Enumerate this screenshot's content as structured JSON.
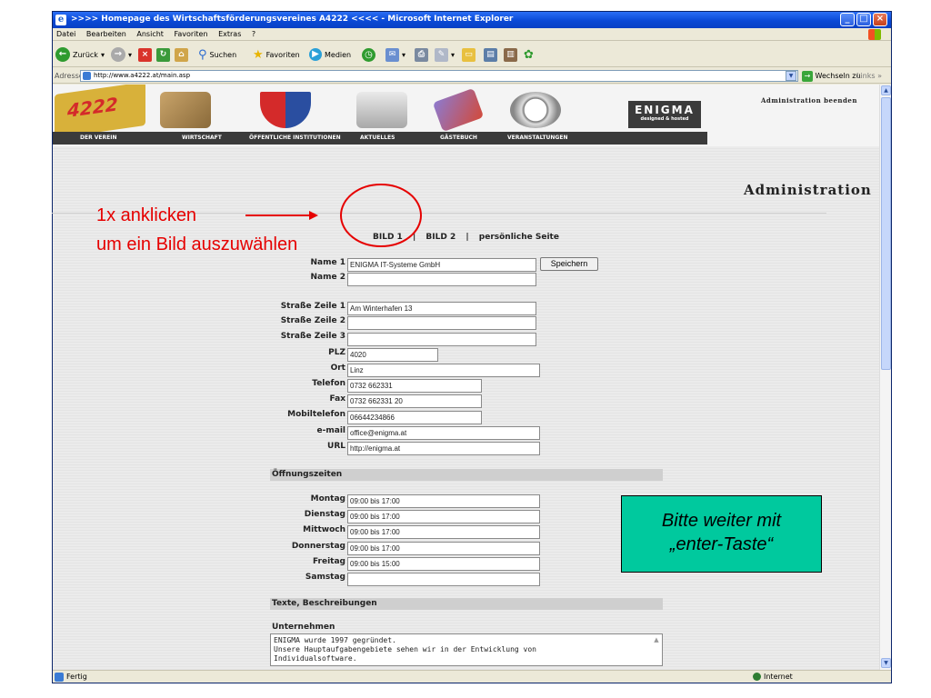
{
  "window": {
    "title": ">>>> Homepage des Wirtschaftsförderungsvereines A4222 <<<< - Microsoft Internet Explorer"
  },
  "menu": [
    "Datei",
    "Bearbeiten",
    "Ansicht",
    "Favoriten",
    "Extras",
    "?"
  ],
  "toolbar": {
    "back": "Zurück",
    "search": "Suchen",
    "favorites": "Favoriten",
    "media": "Medien"
  },
  "address": {
    "label": "Adresse",
    "url": "http://www.a4222.at/main.asp",
    "go": "Wechseln zu",
    "links": "Links"
  },
  "banner": {
    "logo": "4222",
    "nav": [
      "DER VEREIN",
      "WIRTSCHAFT",
      "ÖFFENTLICHE INSTITUTIONEN",
      "AKTUELLES",
      "GÄSTEBUCH",
      "VERANSTALTUNGEN"
    ],
    "enigma": "ENIGMA",
    "enigma_sub": "designed & hosted"
  },
  "admin": {
    "end_link": "Administration beenden",
    "title": "Administration"
  },
  "tabs": [
    "BILD 1",
    "|",
    "BILD 2",
    "|",
    "persönliche Seite"
  ],
  "form": {
    "save_label": "Speichern",
    "name1_label": "Name 1",
    "name1_value": "ENIGMA IT-Systeme GmbH",
    "name2_label": "Name 2",
    "name2_value": "",
    "street1_label": "Straße Zeile 1",
    "street1_value": "Am Winterhafen 13",
    "street2_label": "Straße Zeile 2",
    "street2_value": "",
    "street3_label": "Straße Zeile 3",
    "street3_value": "",
    "plz_label": "PLZ",
    "plz_value": "4020",
    "ort_label": "Ort",
    "ort_value": "Linz",
    "tel_label": "Telefon",
    "tel_value": "0732 662331",
    "fax_label": "Fax",
    "fax_value": "0732 662331 20",
    "mobile_label": "Mobiltelefon",
    "mobile_value": "06644234866",
    "email_label": "e-mail",
    "email_value": "office@enigma.at",
    "url_label": "URL",
    "url_value": "http://enigma.at"
  },
  "hours": {
    "heading": "Öffnungszeiten",
    "mo_label": "Montag",
    "mo_value": "09:00 bis 17:00",
    "di_label": "Dienstag",
    "di_value": "09:00 bis 17:00",
    "mi_label": "Mittwoch",
    "mi_value": "09:00 bis 17:00",
    "do_label": "Donnerstag",
    "do_value": "09:00 bis 17:00",
    "fr_label": "Freitag",
    "fr_value": "09:00 bis 15:00",
    "sa_label": "Samstag",
    "sa_value": ""
  },
  "texts": {
    "heading": "Texte, Beschreibungen",
    "company_label": "Unternehmen",
    "company_value": "ENIGMA wurde 1997 gegründet.\nUnsere Hauptaufgabengebiete sehen wir in der Entwicklung von\nIndividualsoftware."
  },
  "status": {
    "text": "Fertig",
    "zone": "Internet"
  },
  "annotation": {
    "line1": "1x anklicken",
    "line2": "um ein Bild auszuwählen",
    "callout_line1": "Bitte weiter mit",
    "callout_line2": "„enter-Taste“",
    "color": "#e60000",
    "callout_bg": "#00c99e"
  }
}
